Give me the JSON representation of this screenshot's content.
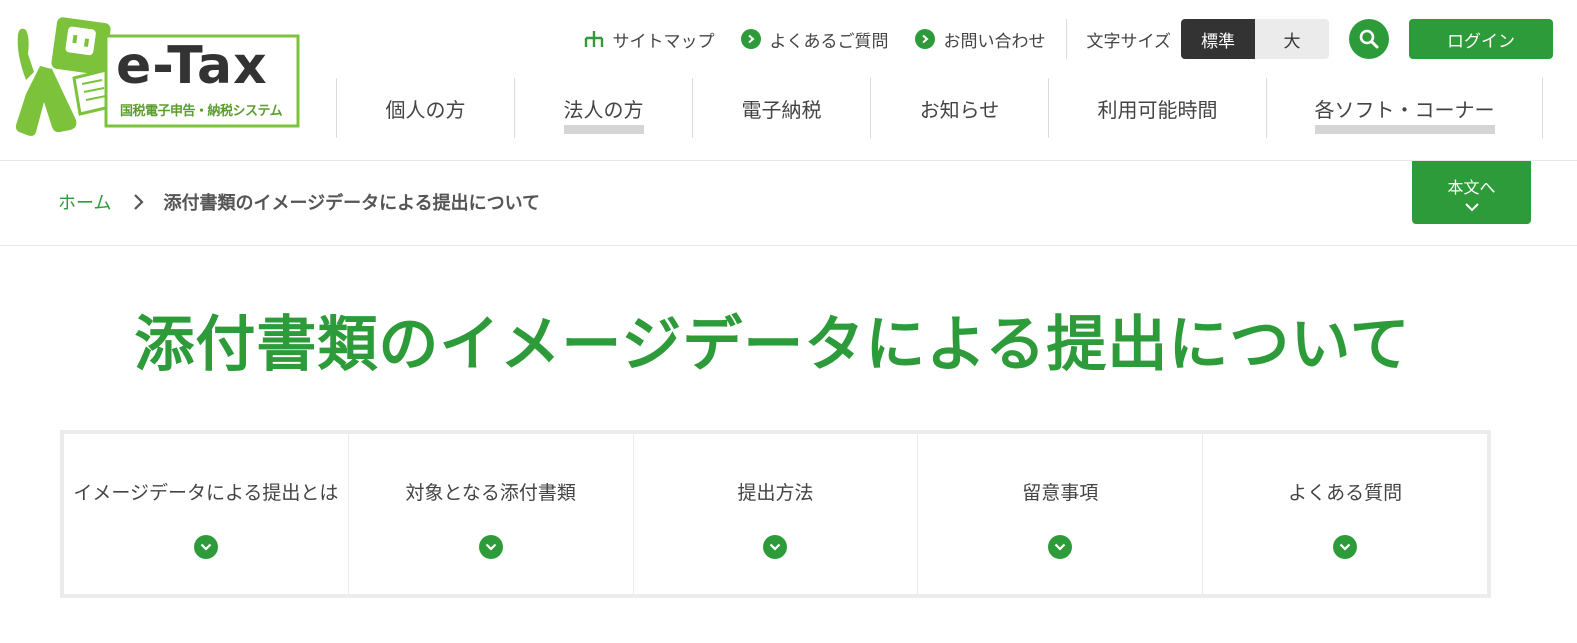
{
  "logo": {
    "text": "e-Tax",
    "subtitle": "国税電子申告・納税システム"
  },
  "utility": {
    "links": [
      {
        "label": "サイトマップ",
        "icon": "sitemap-icon"
      },
      {
        "label": "よくあるご質問",
        "icon": "chevron-right-circle-icon"
      },
      {
        "label": "お問い合わせ",
        "icon": "chevron-right-circle-icon"
      }
    ],
    "font_size_label": "文字サイズ",
    "font_size_options": [
      "標準",
      "大"
    ],
    "font_size_selected": "標準",
    "search_icon": "search-icon",
    "login_label": "ログイン"
  },
  "nav": {
    "items": [
      {
        "label": "個人の方"
      },
      {
        "label": "法人の方"
      },
      {
        "label": "電子納税"
      },
      {
        "label": "お知らせ"
      },
      {
        "label": "利用可能時間"
      },
      {
        "label": "各ソフト・コーナー"
      }
    ]
  },
  "breadcrumb": {
    "home": "ホーム",
    "current": "添付書類のイメージデータによる提出について"
  },
  "skip_link": {
    "label": "本文へ"
  },
  "page": {
    "title": "添付書類のイメージデータによる提出について"
  },
  "tabs": [
    {
      "label": "イメージデータによる提出とは"
    },
    {
      "label": "対象となる添付書類"
    },
    {
      "label": "提出方法"
    },
    {
      "label": "留意事項"
    },
    {
      "label": "よくある質問"
    }
  ],
  "colors": {
    "brand_green": "#2e9b3a",
    "logo_green": "#7cc33b",
    "dark": "#333333"
  }
}
